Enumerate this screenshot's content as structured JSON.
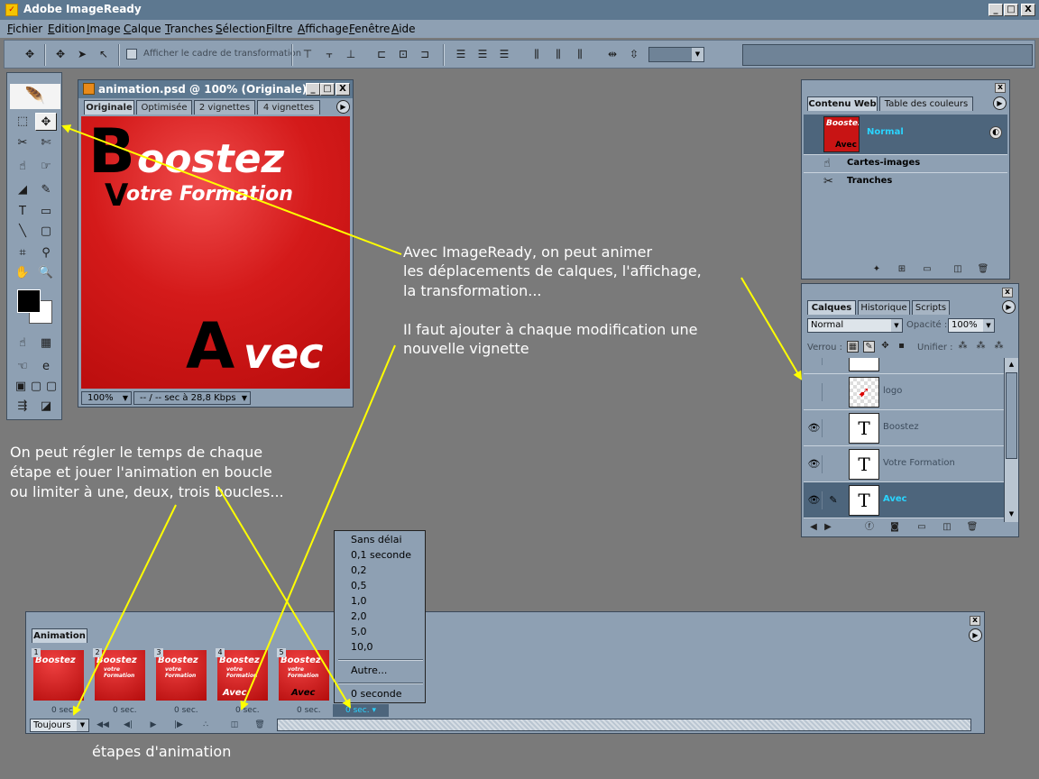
{
  "window": {
    "title": "Adobe ImageReady",
    "icon": "imageready-app-icon",
    "controls": [
      "_",
      "□",
      "X"
    ]
  },
  "menu": {
    "items": [
      "Fichier",
      "Edition",
      "Image",
      "Calque",
      "Tranches",
      "Sélection",
      "Filtre",
      "Affichage",
      "Fenêtre",
      "Aide"
    ]
  },
  "options_bar": {
    "checkbox_label": "Afficher le cadre de transformation",
    "checked": false
  },
  "document": {
    "title": "animation.psd @ 100% (Originale)",
    "tabs": [
      "Originale",
      "Optimisée",
      "2 vignettes",
      "4 vignettes"
    ],
    "active_tab": "Originale",
    "canvas_text": {
      "boostez_initial": "B",
      "boostez_rest": "oostez",
      "votre_initial": "V",
      "votre_rest": "otre Formation",
      "avec_initial": "A",
      "avec_rest": "vec"
    },
    "zoom": "100%",
    "download_info": "-- / -- sec à 28,8 Kbps"
  },
  "web_panel": {
    "tabs": [
      "Contenu Web",
      "Table des couleurs"
    ],
    "active_tab": "Contenu Web",
    "rows": {
      "normal_label": "Normal",
      "thumb_text_1": "Boostez",
      "thumb_text_2": "Avec",
      "image_maps": "Cartes-images",
      "slices": "Tranches"
    }
  },
  "layers_panel": {
    "tabs": [
      "Calques",
      "Historique",
      "Scripts"
    ],
    "active_tab": "Calques",
    "blend_mode": "Normal",
    "opacity_label": "Opacité :",
    "opacity": "100%",
    "lock_label": "Verrou :",
    "unify_label": "Unifier :",
    "layers": [
      {
        "name": "",
        "visible": false,
        "selected": false
      },
      {
        "name": "logo",
        "visible": false,
        "selected": false
      },
      {
        "name": "Boostez",
        "visible": true,
        "selected": false
      },
      {
        "name": "Votre Formation",
        "visible": true,
        "selected": false
      },
      {
        "name": "Avec",
        "visible": true,
        "selected": true
      }
    ],
    "thumb_glyph": "T"
  },
  "animation_panel": {
    "tab": "Animation",
    "frames": [
      {
        "number": "1",
        "delay": "0 sec."
      },
      {
        "number": "2",
        "delay": "0 sec."
      },
      {
        "number": "3",
        "delay": "0 sec."
      },
      {
        "number": "4",
        "delay": "0 sec."
      },
      {
        "number": "5",
        "delay": "0 sec."
      }
    ],
    "selected_delay": "0 sec.",
    "frame_text": {
      "boostez": "Boostez",
      "votre_formation": "votre Formation",
      "avec": "Avec"
    },
    "loop_option": "Toujours"
  },
  "delay_menu": {
    "items": [
      "Sans délai",
      "0,1 seconde",
      "0,2",
      "0,5",
      "1,0",
      "2,0",
      "5,0",
      "10,0"
    ],
    "other": "Autre...",
    "current": "0 seconde"
  },
  "annotations": {
    "top_right": [
      "Avec ImageReady, on peut animer",
      "les déplacements de calques, l'affichage,",
      "la transformation...",
      "",
      "Il faut ajouter à chaque modification une",
      "nouvelle vignette"
    ],
    "left": [
      "On peut régler le temps de chaque",
      "étape et jouer l'animation en boucle",
      "ou limiter à une, deux, trois boucles..."
    ],
    "bottom": "étapes d'animation"
  },
  "colors": {
    "title_bar": "#5d7890",
    "panel": "#8ea0b3",
    "selection": "#4d657c",
    "highlight_text": "#2ad4ff",
    "canvas_red": "#d41a1a",
    "annotation_arrow": "#ffff00",
    "desktop": "#7a7a7a"
  }
}
